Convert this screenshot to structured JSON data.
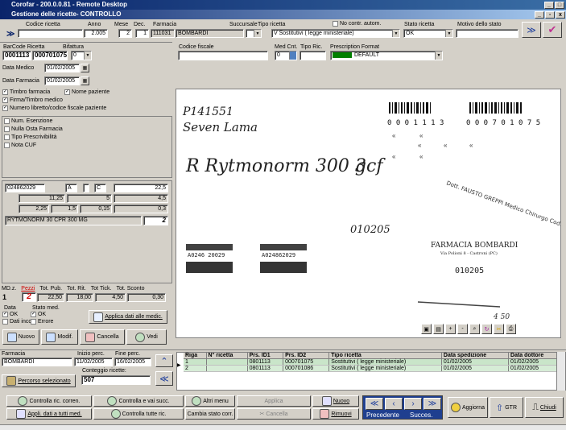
{
  "window": {
    "title": "Corofar - 200.0.0.81 - Remote Desktop",
    "inner_title": "Gestione delle ricette- CONTROLLO"
  },
  "header": {
    "codice_ricetta_label": "Codice ricetta",
    "anno_label": "Anno",
    "mese_label": "Mese",
    "dec_label": "Dec.",
    "farmacia_label": "Farmacia",
    "anno": "2.005",
    "mese": "2",
    "dec": "1",
    "farmacia_code": "111031",
    "farmacia_name": "BOMBARDI",
    "succursale_label": "Succursale",
    "tipo_ricetta_label": "Tipo ricetta",
    "no_contr_label": "No contr. autom.",
    "tipo_ricetta": "V  Sostitutivi ( legge ministeriale)",
    "stato_label": "Stato ricetta",
    "stato": "OK",
    "motivo_label": "Motivo dello stato"
  },
  "left": {
    "barcode_label": "BarCode Ricetta",
    "bifattura_label": "Bifattura",
    "barcode1": "0001113",
    "barcode2": "000701075",
    "bifattura": "0",
    "data_medico_label": "Data Medico",
    "data_medico": "01/02/2005",
    "data_farmacia_label": "Data Farmacia",
    "data_farmacia": "01/02/2005",
    "checks1": [
      "Timbro farmacia",
      "Firma/Timbro medico",
      "Numero libretto/codice fiscale paziente"
    ],
    "nome_paziente": "Nome paziente",
    "checks2": [
      "Num. Esenzione",
      "Nulla Osta Farmacia",
      "Tipo Prescrivibilità",
      "Nota CUF"
    ],
    "drug": {
      "code": "024862029",
      "a": "A",
      "c": "C",
      "v1": "22,5",
      "v2": "11,25",
      "v3": "5",
      "v4": "4,5",
      "v5": "2,25",
      "v6": "1,5",
      "v7": "0,15",
      "v8": "0,3",
      "name": "RYTMONORM 30 CPR 300 MG",
      "qty": "2"
    },
    "totals": {
      "headers": [
        "MD.z.",
        "Pezzi",
        "Tot. Pub.",
        "Tot. Rit.",
        "Tot Tick.",
        "Tot. Sconto"
      ],
      "values": [
        "1",
        "2",
        "22,50",
        "18,00",
        "4,50",
        "0,30"
      ]
    },
    "data_label": "Data",
    "stato_med_label": "Stato med.",
    "ok1": "OK",
    "dati_incon": "Dati incon",
    "ok2": "OK",
    "errore": "Errore",
    "applica": "Applica dati alle medic.",
    "nuovo": "Nuovo",
    "modif": "Modif.",
    "cancella": "Cancella",
    "vedi": "Vedi"
  },
  "center": {
    "codice_fiscale_label": "Codice fiscale",
    "med_cnt_label": "Med Cnt.",
    "tipo_ric_label": "Tipo Ric.",
    "prescription_label": "Prescription Format",
    "med_cnt": "0",
    "prescription": "DEFAULT"
  },
  "scan": {
    "hand1": "P141551",
    "hand2": "Seven Lama",
    "hand3": "R Rytmonorm 300 g",
    "hand4": "3cf",
    "hand5": "010205",
    "barcode_num1": "0 0 0 1 1 1 3",
    "barcode_num2": "0 0 0 7 0 1 0 7 5",
    "stamp": "Dott. FAUSTO GREPPI Medico Chirurgo Cod. Reg. 18645",
    "pharmacy1": "FARMACIA BOMBARDI",
    "pharmacy2": "Via Polioni 8 - Castroni (PC)",
    "pharmacy3": "010205",
    "sig": "4 50",
    "code1": "A0246 20029",
    "code2": "A024862029"
  },
  "bottom": {
    "farmacia_label": "Farmacia",
    "inizio_label": "Inizio perc.",
    "fine_label": "Fine perc.",
    "farmacia": "BOMBARDI",
    "inizio": "11/02/2005",
    "fine": "16/02/2005",
    "conteggio_label": "Conteggio ricette:",
    "conteggio": "507",
    "percorso": "Percorso selezionato",
    "table": {
      "headers": [
        "Riga",
        "N° ricetta",
        "Prs. ID1",
        "Prs. ID2",
        "Tipo ricetta",
        "Data spedizione",
        "Data dottore"
      ],
      "rows": [
        [
          "1",
          "",
          "0801113",
          "000701075",
          "Sostitutivi ( legge ministeriale)",
          "01/02/2005",
          "01/02/2005"
        ],
        [
          "2",
          "",
          "0801113",
          "000701086",
          "Sostitutivi ( legge ministeriale)",
          "01/02/2005",
          "01/02/2005"
        ]
      ]
    }
  },
  "toolbar": {
    "controlla_ric": "Controlla ric. corren.",
    "appli_dati": "Appli. dati a tutti med.",
    "controlla_succ": "Controlla e vai succ.",
    "controlla_tutte": "Controlla tutte ric.",
    "altri_menu": "Altri menu",
    "cambia_stato": "Cambia stato corr.",
    "applica": "Applica",
    "cancella": "Cancella",
    "nuovo": "Nuovo",
    "rimuovi": "Rimuovi",
    "precedente": "Precedente",
    "successivo": "Succes.",
    "aggiorna": "Aggiorna",
    "gtr": "GTR",
    "chiudi": "Chiudi"
  }
}
